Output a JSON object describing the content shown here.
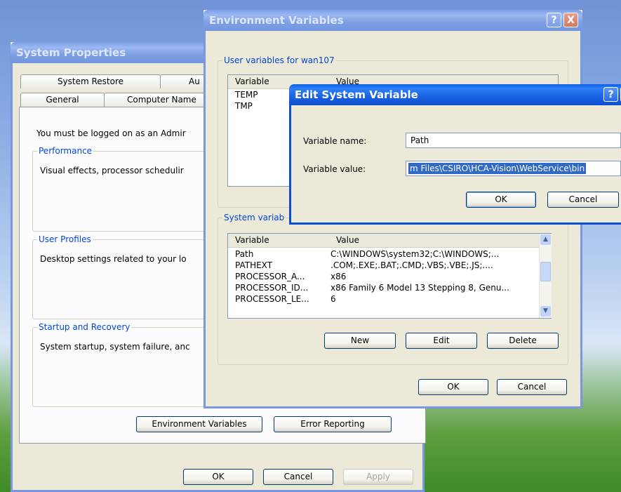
{
  "system_properties": {
    "title": "System Properties",
    "tabs_row1": [
      "System Restore",
      "Au"
    ],
    "tabs_row2": [
      "General",
      "Computer Name"
    ],
    "admin_note": "You must be logged on as an Admir",
    "performance": {
      "label": "Performance",
      "text": "Visual effects, processor schedulir"
    },
    "user_profiles": {
      "label": "User Profiles",
      "text": "Desktop settings related to your lo"
    },
    "startup": {
      "label": "Startup and Recovery",
      "text": "System startup, system failure, anc"
    },
    "env_button": "Environment Variables",
    "error_button": "Error Reporting",
    "ok": "OK",
    "cancel": "Cancel",
    "apply": "Apply"
  },
  "env_vars": {
    "title": "Environment Variables",
    "help": "?",
    "close": "X",
    "user_group_label": "User variables for wan107",
    "user_headers": [
      "Variable",
      "Value"
    ],
    "user_rows": [
      "TEMP",
      "TMP"
    ],
    "system_group_label": "System variab",
    "system_headers": [
      "Variable",
      "Value"
    ],
    "system_rows": [
      {
        "name": "Path",
        "value": "C:\\WINDOWS\\system32;C:\\WINDOWS;..."
      },
      {
        "name": "PATHEXT",
        "value": ".COM;.EXE;.BAT;.CMD;.VBS;.VBE;.JS;...."
      },
      {
        "name": "PROCESSOR_A...",
        "value": "x86"
      },
      {
        "name": "PROCESSOR_ID...",
        "value": "x86 Family 6 Model 13 Stepping 8, Genu..."
      },
      {
        "name": "PROCESSOR_LE...",
        "value": "6"
      }
    ],
    "new": "New",
    "edit": "Edit",
    "delete": "Delete",
    "ok": "OK",
    "cancel": "Cancel"
  },
  "edit_var": {
    "title": "Edit System Variable",
    "help": "?",
    "close": "X",
    "name_label": "Variable name:",
    "name_value": "Path",
    "value_label": "Variable value:",
    "value_value": "m Files\\CSIRO\\HCA-Vision\\WebService\\bin",
    "ok": "OK",
    "cancel": "Cancel"
  }
}
